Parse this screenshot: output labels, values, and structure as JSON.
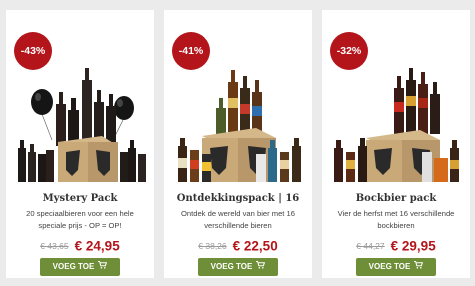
{
  "products": [
    {
      "badge": "-43%",
      "title": "Mystery Pack",
      "description": "20 speciaalbieren voor een hele speciale prijs - OP = OP!",
      "old_price": "€ 43,65",
      "price": "€ 24,95",
      "button": "VOEG TOE",
      "image": "mystery-pack-bottles-balloons"
    },
    {
      "badge": "-41%",
      "title": "Ontdekkingspack | 16",
      "description": "Ontdek de wereld van bier met 16 verschillende bieren",
      "old_price": "€ 38,26",
      "price": "€ 22,50",
      "button": "VOEG TOE",
      "image": "ontdekkingspack-bottles-box"
    },
    {
      "badge": "-32%",
      "title": "Bockbier pack",
      "description": "Vier de herfst met 16 verschillende bockbieren",
      "old_price": "€ 44,27",
      "price": "€ 29,95",
      "button": "VOEG TOE",
      "image": "bockbier-pack-bottles-box"
    }
  ],
  "colors": {
    "accent": "#b3151b",
    "button": "#6e8e37",
    "background": "#ebebeb"
  },
  "icons": {
    "cart": "shopping-cart-icon"
  }
}
